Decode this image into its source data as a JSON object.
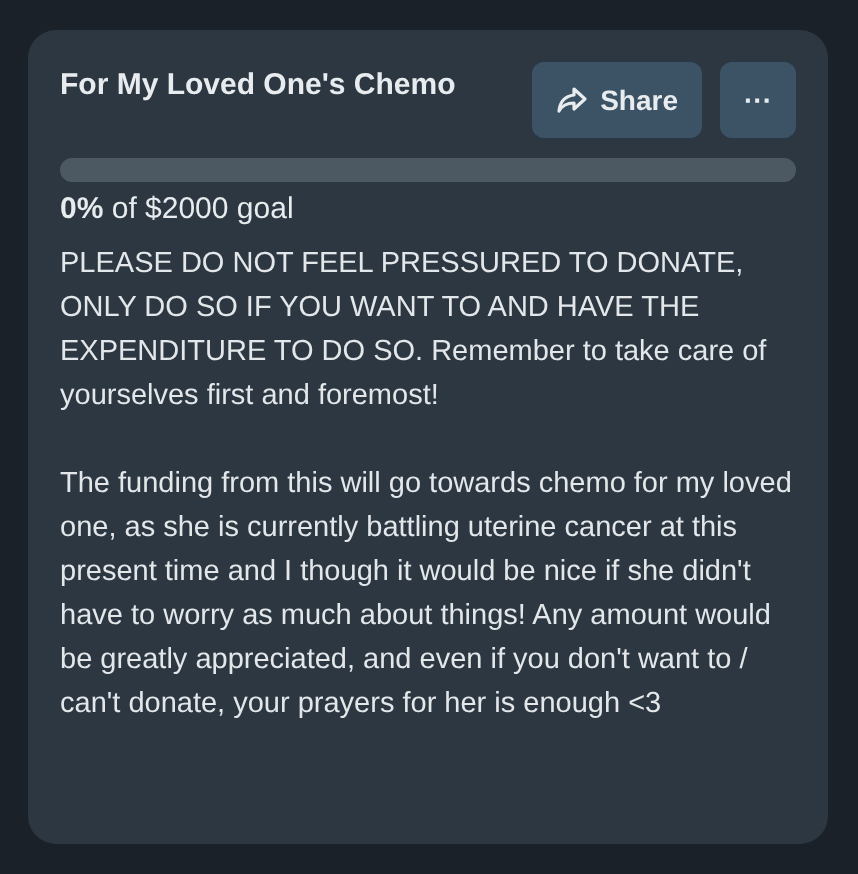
{
  "card": {
    "title": "For My Loved One's Chemo",
    "share_button": "Share",
    "more_button": "···",
    "progress": {
      "level": 0,
      "caption": "**0%** of $2000 goal"
    },
    "description": [
      "PLEASE DO NOT FEEL PRESSURED TO DONATE, ONLY DO SO IF YOU WANT TO AND HAVE THE EXPENDITURE TO DO SO. Remember to take care of yourselves first and foremost!",
      "The funding from this will go towards chemo for my loved one, as she is currently battling uterine cancer at this present time and I though it would be nice if she didn't have to worry as much about things! Any amount would be greatly appreciated, and even if you don't want to / can't donate, your prayers for her is enough <3"
    ]
  }
}
